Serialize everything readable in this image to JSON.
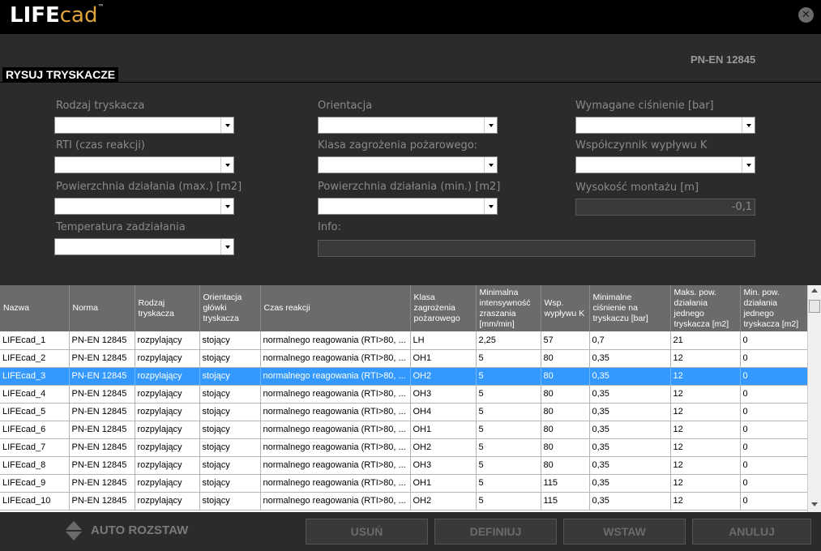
{
  "app": {
    "logo_main": "LIFE",
    "logo_accent": "cad",
    "logo_tm": "™",
    "close": "✕"
  },
  "header": {
    "norm": "PN-EN 12845",
    "section_title": "RYSUJ TRYSKACZE"
  },
  "form": {
    "rodzaj_label": "Rodzaj tryskacza",
    "orientacja_label": "Orientacja",
    "cisnienie_label": "Wymagane ciśnienie [bar]",
    "rti_label": "RTI (czas reakcji)",
    "klasa_label": "Klasa zagrożenia pożarowego:",
    "wspolczynnik_label": "Współczynnik wypływu K",
    "pow_max_label": "Powierzchnia działania (max.) [m2]",
    "pow_min_label": "Powierzchnia działania (min.) [m2]",
    "wysokosc_label": "Wysokość montażu [m]",
    "wysokosc_value": "-0,1",
    "temperatura_label": "Temperatura zadziałania",
    "info_label": "Info:"
  },
  "table": {
    "headers": [
      "Nazwa",
      "Norma",
      "Rodzaj tryskacza",
      "Orientacja główki tryskacza",
      "Czas reakcji",
      "Klasa zagrożenia pożarowego",
      "Minimalna intensywność zraszania [mm/min]",
      "Wsp. wypływu K",
      "Minimalne ciśnienie na tryskaczu [bar]",
      "Maks. pow. działania jednego tryskacza [m2]",
      "Min. pow. działania jednego tryskacza [m2]"
    ],
    "rows": [
      [
        "LIFEcad_1",
        "PN-EN 12845",
        "rozpylający",
        "stojący",
        "normalnego reagowania (RTI>80, ...",
        "LH",
        "2,25",
        "57",
        "0,7",
        "21",
        "0"
      ],
      [
        "LIFEcad_2",
        "PN-EN 12845",
        "rozpylający",
        "stojący",
        "normalnego reagowania (RTI>80, ...",
        "OH1",
        "5",
        "80",
        "0,35",
        "12",
        "0"
      ],
      [
        "LIFEcad_3",
        "PN-EN 12845",
        "rozpylający",
        "stojący",
        "normalnego reagowania (RTI>80, ...",
        "OH2",
        "5",
        "80",
        "0,35",
        "12",
        "0"
      ],
      [
        "LIFEcad_4",
        "PN-EN 12845",
        "rozpylający",
        "stojący",
        "normalnego reagowania (RTI>80, ...",
        "OH3",
        "5",
        "80",
        "0,35",
        "12",
        "0"
      ],
      [
        "LIFEcad_5",
        "PN-EN 12845",
        "rozpylający",
        "stojący",
        "normalnego reagowania (RTI>80, ...",
        "OH4",
        "5",
        "80",
        "0,35",
        "12",
        "0"
      ],
      [
        "LIFEcad_6",
        "PN-EN 12845",
        "rozpylający",
        "stojący",
        "normalnego reagowania (RTI>80, ...",
        "OH1",
        "5",
        "80",
        "0,35",
        "12",
        "0"
      ],
      [
        "LIFEcad_7",
        "PN-EN 12845",
        "rozpylający",
        "stojący",
        "normalnego reagowania (RTI>80, ...",
        "OH2",
        "5",
        "80",
        "0,35",
        "12",
        "0"
      ],
      [
        "LIFEcad_8",
        "PN-EN 12845",
        "rozpylający",
        "stojący",
        "normalnego reagowania (RTI>80, ...",
        "OH3",
        "5",
        "80",
        "0,35",
        "12",
        "0"
      ],
      [
        "LIFEcad_9",
        "PN-EN 12845",
        "rozpylający",
        "stojący",
        "normalnego reagowania (RTI>80, ...",
        "OH1",
        "5",
        "115",
        "0,35",
        "12",
        "0"
      ],
      [
        "LIFEcad_10",
        "PN-EN 12845",
        "rozpylający",
        "stojący",
        "normalnego reagowania (RTI>80, ...",
        "OH2",
        "5",
        "115",
        "0,35",
        "12",
        "0"
      ]
    ],
    "selected_row": 2
  },
  "footer": {
    "auto_label": "AUTO ROZSTAW",
    "usun": "USUŃ",
    "definiuj": "DEFINIUJ",
    "wstaw": "WSTAW",
    "anuluj": "ANULUJ"
  },
  "colors": {
    "selection": "#3399ff",
    "header_bg": "#6b6b6b",
    "logo_accent": "#e0a23a"
  }
}
